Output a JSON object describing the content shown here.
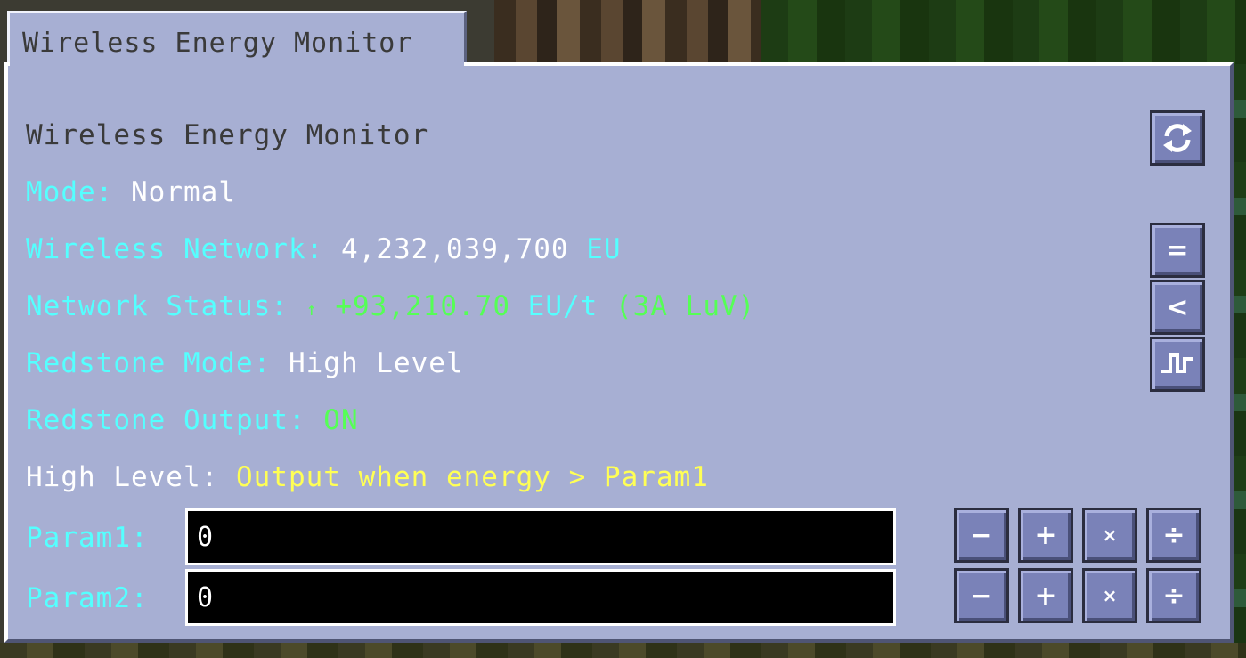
{
  "window": {
    "tab_title": "Wireless Energy Monitor"
  },
  "info": {
    "title": "Wireless Energy Monitor",
    "mode_label": "Mode:",
    "mode_value": "Normal",
    "network_label": "Wireless Network:",
    "network_value": "4,232,039,700",
    "network_unit": "EU",
    "status_label": "Network Status:",
    "status_arrow": "↑",
    "status_value": "+93,210.70",
    "status_unit": "EU/t",
    "status_amps": "(3A LuV)",
    "redstone_mode_label": "Redstone Mode:",
    "redstone_mode_value": "High Level",
    "redstone_output_label": "Redstone Output:",
    "redstone_output_value": "ON",
    "level_desc_label": "High Level:",
    "level_desc_value": "Output when energy > Param1"
  },
  "params": [
    {
      "label": "Param1:",
      "value": "0"
    },
    {
      "label": "Param2:",
      "value": "0"
    }
  ],
  "side_buttons": {
    "refresh": "refresh-icon",
    "equals": "=",
    "less_than": "<",
    "signal": "redstone-signal-icon"
  },
  "math_buttons": {
    "minus": "−",
    "plus": "+",
    "times": "×",
    "divide": "÷"
  },
  "colors": {
    "panel": "#a7afd3",
    "aqua": "#55ffff",
    "green": "#55ff55",
    "yellow": "#ffff55",
    "button": "#7a82b8"
  }
}
